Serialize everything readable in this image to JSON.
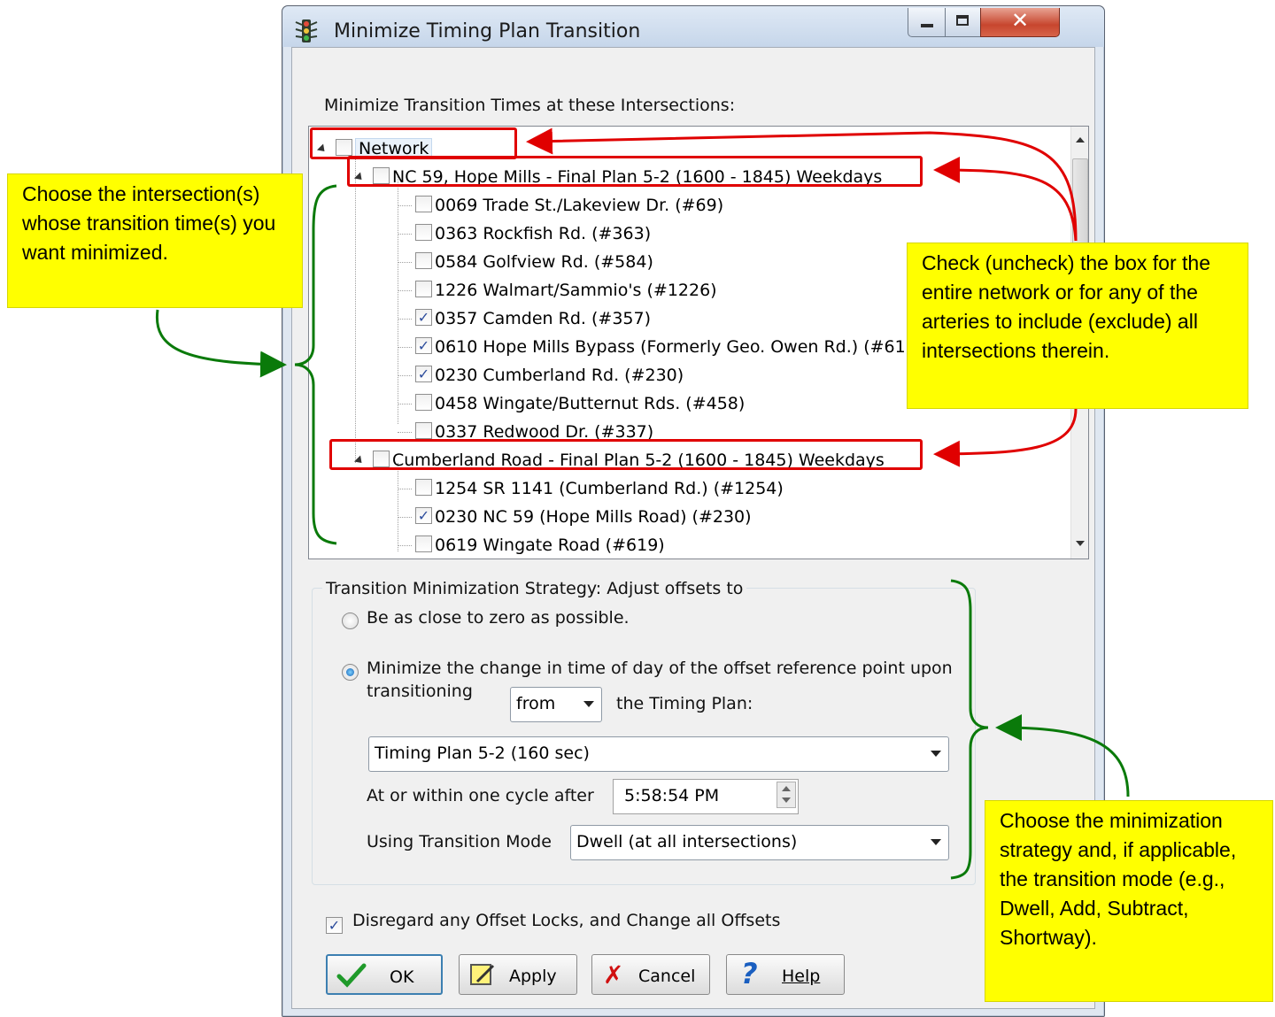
{
  "window": {
    "title": "Minimize Timing Plan Transition"
  },
  "tree": {
    "label": "Minimize Transition Times at these Intersections:",
    "network": {
      "label": "Network",
      "checked": false
    },
    "arteries": [
      {
        "label": "NC 59, Hope Mills -  Final Plan 5-2 (1600 - 1845) Weekdays",
        "checked": false,
        "items": [
          {
            "label": "0069 Trade St./Lakeview Dr. (#69)",
            "checked": false
          },
          {
            "label": "0363 Rockfish Rd. (#363)",
            "checked": false
          },
          {
            "label": "0584 Golfview Rd. (#584)",
            "checked": false
          },
          {
            "label": "1226 Walmart/Sammio's (#1226)",
            "checked": false
          },
          {
            "label": "0357 Camden Rd. (#357)",
            "checked": true
          },
          {
            "label": "0610 Hope Mills Bypass (Formerly Geo. Owen Rd.) (#61",
            "checked": true
          },
          {
            "label": "0230 Cumberland Rd. (#230)",
            "checked": true
          },
          {
            "label": "0458 Wingate/Butternut Rds. (#458)",
            "checked": false
          },
          {
            "label": "0337 Redwood Dr. (#337)",
            "checked": false
          }
        ]
      },
      {
        "label": "Cumberland Road -  Final Plan 5-2 (1600 - 1845) Weekdays",
        "checked": false,
        "items": [
          {
            "label": "1254 SR 1141 (Cumberland Rd.) (#1254)",
            "checked": false
          },
          {
            "label": "0230 NC 59 (Hope Mills Road) (#230)",
            "checked": true
          },
          {
            "label": "0619 Wingate Road (#619)",
            "checked": false
          }
        ]
      }
    ]
  },
  "strategy": {
    "title": "Transition Minimization Strategy:  Adjust offsets to",
    "option_zero": "Be as close to zero as possible.",
    "option_minimize_line1": "Minimize the change in time of day of the offset reference point upon",
    "option_minimize_line2": "transitioning",
    "selected": "minimize",
    "direction_value": "from",
    "timing_plan_label": "the Timing Plan:",
    "timing_plan_value": "Timing Plan 5-2 (160 sec)",
    "cycle_label": "At or within one cycle after",
    "time_value": "5:58:54 PM",
    "mode_label": "Using Transition Mode",
    "mode_value": "Dwell  (at all intersections)"
  },
  "disregard": {
    "label": "Disregard any Offset Locks, and Change all Offsets",
    "checked": true
  },
  "buttons": {
    "ok": "OK",
    "apply": "Apply",
    "cancel": "Cancel",
    "help": "Help"
  },
  "annotations": {
    "left_note": "Choose the intersection(s) whose transition time(s) you want minimized.",
    "right_note": "Check (uncheck) the box for the entire network or for any of the arteries to include (exclude) all intersections therein.",
    "bottom_note": "Choose the minimization strategy and, if applicable, the transition mode (e.g., Dwell, Add, Subtract, Shortway).",
    "arrow_red": "#e00000",
    "arrow_green": "#0a7a0a",
    "note_color": "#ffff00"
  }
}
